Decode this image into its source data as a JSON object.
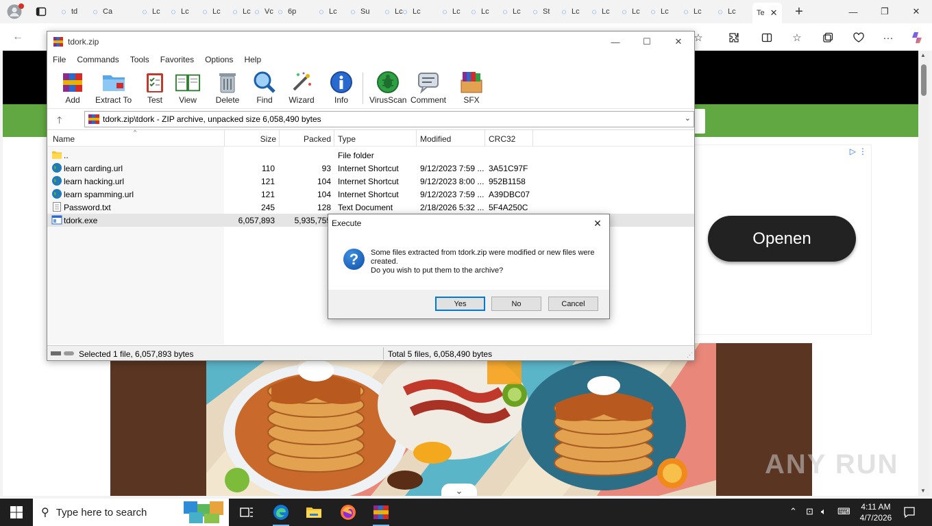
{
  "browser": {
    "tabs": [
      {
        "label": "td"
      },
      {
        "label": "Ca"
      },
      {
        "label": "Lc"
      },
      {
        "label": "Lc"
      },
      {
        "label": "Lc"
      },
      {
        "label": "Lc"
      },
      {
        "label": "Vc"
      },
      {
        "label": "6p"
      },
      {
        "label": "Lc"
      },
      {
        "label": "Su"
      },
      {
        "label": "Lc"
      },
      {
        "label": "Lc"
      },
      {
        "label": "Lc"
      },
      {
        "label": "Lc"
      },
      {
        "label": "Lc"
      },
      {
        "label": "St"
      },
      {
        "label": "Lc"
      },
      {
        "label": "Lc"
      },
      {
        "label": "Lc"
      },
      {
        "label": "Lc"
      },
      {
        "label": "Lc"
      },
      {
        "label": "Lc"
      }
    ],
    "active_tab": {
      "label": "Te"
    }
  },
  "webpage": {
    "open_button": "Openen",
    "watermark": "ANY RUN"
  },
  "winrar": {
    "title": "tdork.zip",
    "menu": [
      "File",
      "Commands",
      "Tools",
      "Favorites",
      "Options",
      "Help"
    ],
    "toolbar": [
      {
        "label": "Add",
        "icon": "add-books-icon"
      },
      {
        "label": "Extract To",
        "icon": "extract-folder-icon"
      },
      {
        "label": "Test",
        "icon": "test-clipboard-icon"
      },
      {
        "label": "View",
        "icon": "view-book-icon"
      },
      {
        "label": "Delete",
        "icon": "trash-icon"
      },
      {
        "label": "Find",
        "icon": "magnifier-icon"
      },
      {
        "label": "Wizard",
        "icon": "wand-icon"
      },
      {
        "label": "Info",
        "icon": "info-icon"
      },
      {
        "label": "VirusScan",
        "icon": "bug-scan-icon"
      },
      {
        "label": "Comment",
        "icon": "comment-icon"
      },
      {
        "label": "SFX",
        "icon": "sfx-box-icon"
      }
    ],
    "path": "tdork.zip\\tdork - ZIP archive, unpacked size 6,058,490 bytes",
    "columns": [
      "Name",
      "Size",
      "Packed",
      "Type",
      "Modified",
      "CRC32"
    ],
    "files": [
      {
        "name": "..",
        "size": "",
        "packed": "",
        "type": "File folder",
        "modified": "",
        "crc": "",
        "icon": "folder-icon"
      },
      {
        "name": "learn carding.url",
        "size": "110",
        "packed": "93",
        "type": "Internet Shortcut",
        "modified": "9/12/2023 7:59 ...",
        "crc": "3A51C97F",
        "icon": "globe-icon"
      },
      {
        "name": "learn hacking.url",
        "size": "121",
        "packed": "104",
        "type": "Internet Shortcut",
        "modified": "9/12/2023 8:00 ...",
        "crc": "952B1158",
        "icon": "globe-icon"
      },
      {
        "name": "learn spamming.url",
        "size": "121",
        "packed": "104",
        "type": "Internet Shortcut",
        "modified": "9/12/2023 7:59 ...",
        "crc": "A39DBC07",
        "icon": "globe-icon"
      },
      {
        "name": "Password.txt",
        "size": "245",
        "packed": "128",
        "type": "Text Document",
        "modified": "2/18/2026 5:32 ...",
        "crc": "5F4A250C",
        "icon": "text-file-icon"
      },
      {
        "name": "tdork.exe",
        "size": "6,057,893",
        "packed": "5,935,755",
        "type": "",
        "modified": "",
        "crc": "",
        "icon": "exe-icon"
      }
    ],
    "status_left": "Selected 1 file, 6,057,893 bytes",
    "status_right": "Total 5 files, 6,058,490 bytes"
  },
  "dialog": {
    "title": "Execute",
    "message_line1": "Some files extracted from tdork.zip were modified or new files were created.",
    "message_line2": "Do you wish to put them to the archive?",
    "yes": "Yes",
    "no": "No",
    "cancel": "Cancel"
  },
  "taskbar": {
    "search_placeholder": "Type here to search",
    "time": "4:11 AM",
    "date": "4/7/2026"
  },
  "colors": {
    "green_bar": "#61a842",
    "dialog_default_border": "#0078d7",
    "taskbar": "#1f1f1f"
  }
}
